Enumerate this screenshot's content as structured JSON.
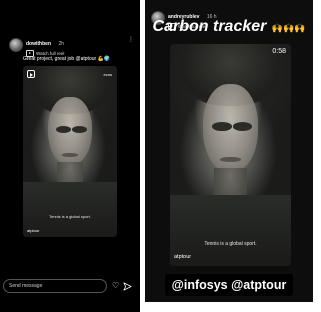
{
  "left_story": {
    "username": "dowithben",
    "time": "2h",
    "subtitle_line": "Watch full reel",
    "caption": "Great project, great job @atptour 💪🌍",
    "reel": {
      "brand_tag": "ecos",
      "subtitle": "Tennis is a global sport.",
      "brand": "atptour"
    },
    "message_placeholder": "Send message"
  },
  "right_story": {
    "username": "andreyrublev",
    "time": "16 h",
    "subtitle_line": "Watch full reel",
    "headline": "Carbon tracker",
    "emoji": "🙌🙌🙌",
    "reel": {
      "duration": "0:58",
      "subtitle": "Tennis is a global sport.",
      "brand": "atptour"
    },
    "mentions": "@infosys @atptour"
  },
  "icons": {
    "more": "more-options-icon",
    "reel": "reel-icon",
    "heart": "heart-icon",
    "send": "send-icon"
  }
}
